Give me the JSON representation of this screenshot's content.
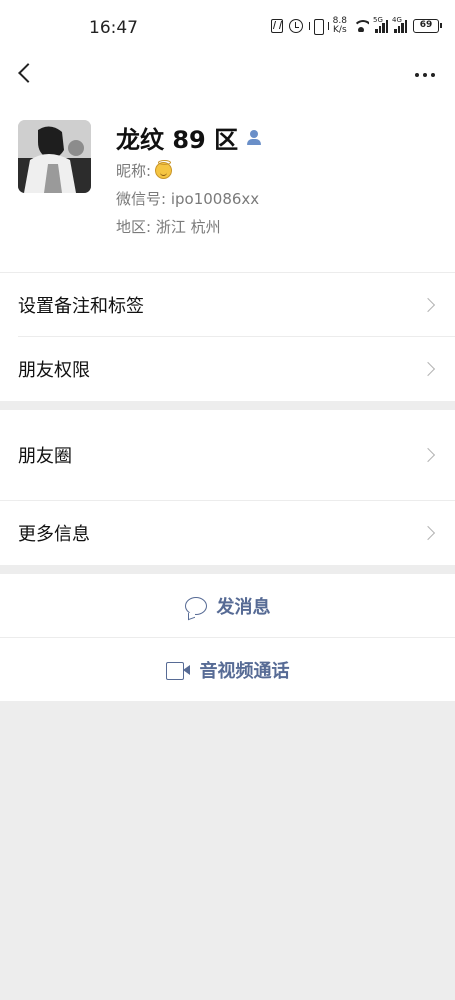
{
  "status_bar": {
    "time": "16:47",
    "speed_value": "8.8",
    "speed_unit": "K/s",
    "signal1_tag": "5G",
    "signal2_tag": "4G",
    "battery": "69"
  },
  "profile": {
    "name": "龙纹 89 区",
    "nickname_label": "昵称:",
    "wechat_id": "微信号:  ipo10086xx",
    "region": "地区:  浙江  杭州"
  },
  "menu": {
    "remark_tags": "设置备注和标签",
    "friend_permissions": "朋友权限",
    "moments": "朋友圈",
    "more_info": "更多信息"
  },
  "actions": {
    "send_message": "发消息",
    "video_call": "音视频通话"
  },
  "colors": {
    "link_blue": "#576b95",
    "background": "#ededed",
    "user_icon": "#6a8fc8"
  }
}
